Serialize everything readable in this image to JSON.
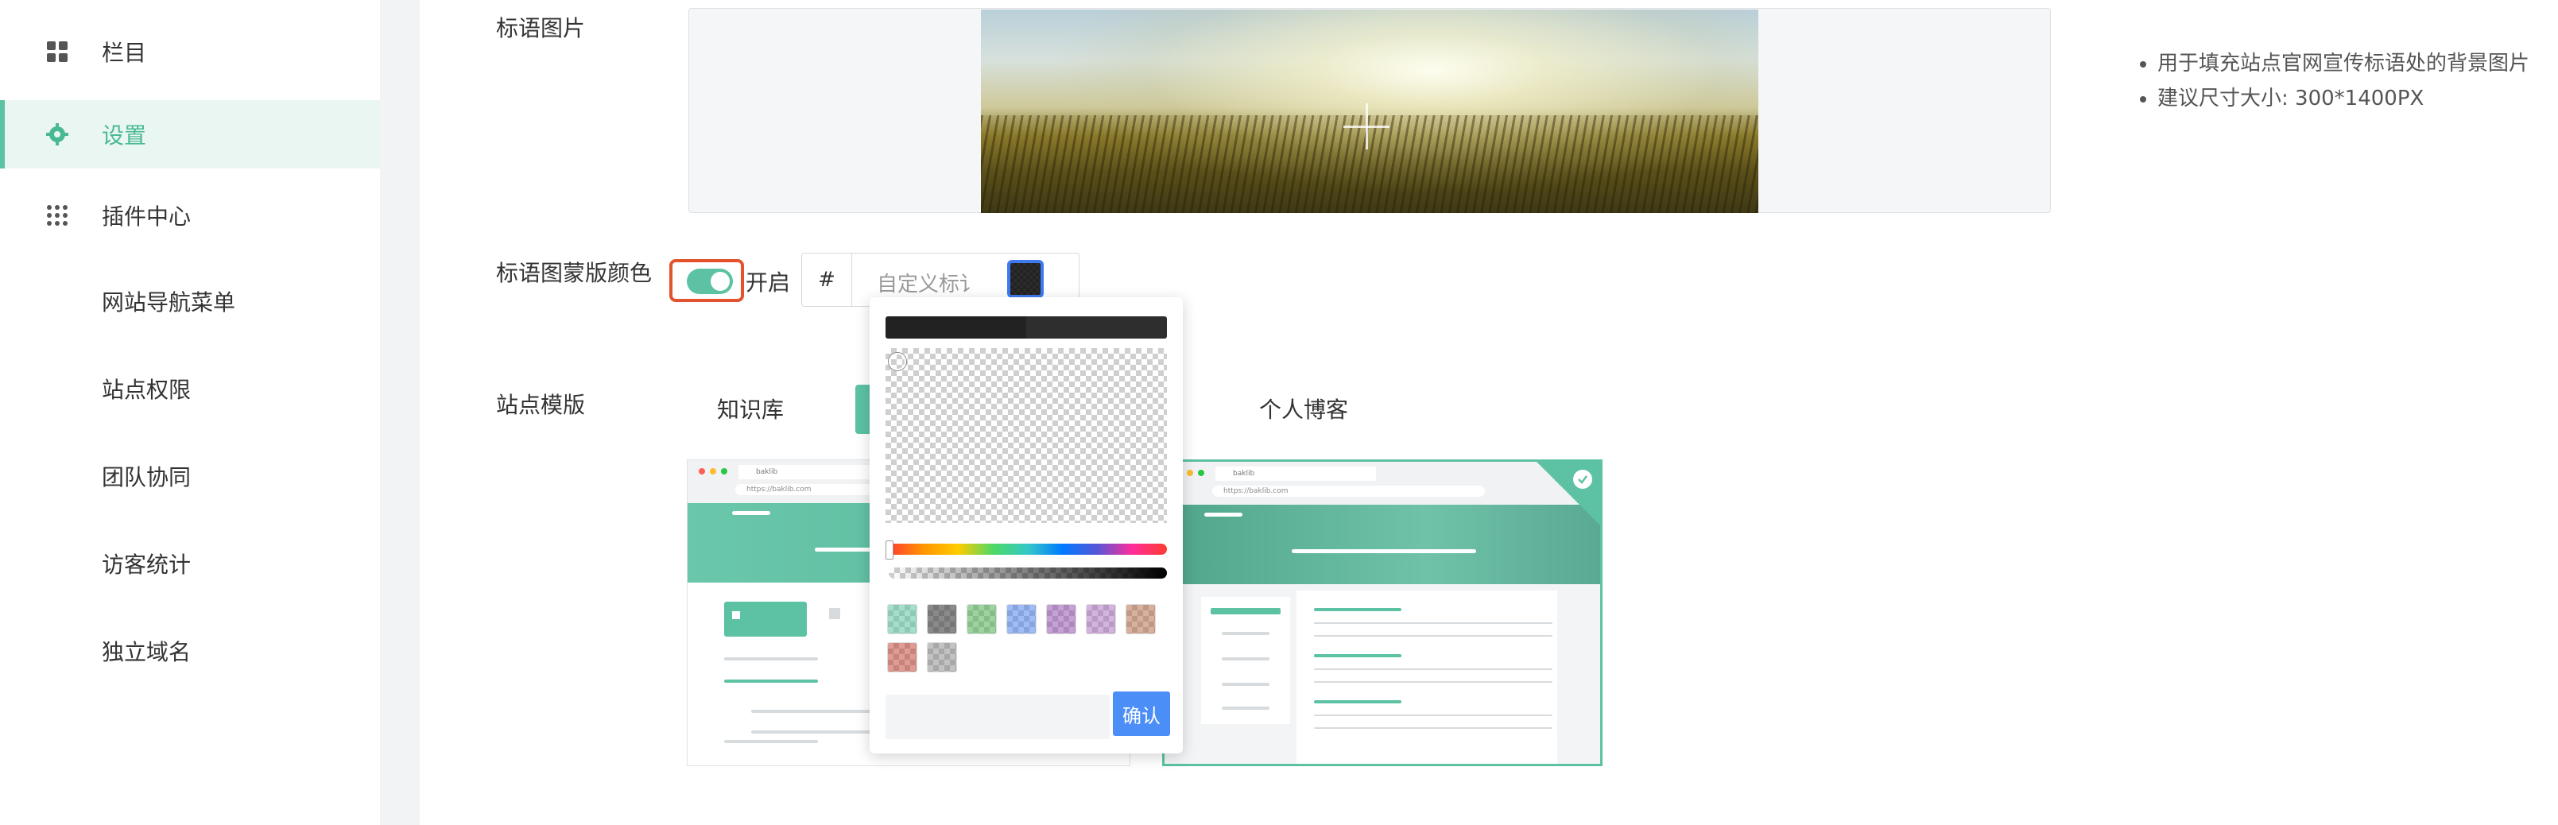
{
  "sidebar": {
    "items": [
      {
        "label": "栏目",
        "icon": "grid-icon"
      },
      {
        "label": "设置",
        "icon": "gear-icon",
        "active": true
      },
      {
        "label": "插件中心",
        "icon": "apps-icon"
      }
    ],
    "sub_items": [
      "网站导航菜单",
      "站点权限",
      "团队协同",
      "访客统计",
      "独立域名"
    ]
  },
  "banner": {
    "label": "标语图片",
    "tips": [
      "用于填充站点官网宣传标语处的背景图片",
      "建议尺寸大小: 300*1400PX"
    ]
  },
  "mask_color": {
    "label": "标语图蒙版颜色",
    "toggle_label": "开启",
    "toggle_on": true,
    "hash": "#",
    "placeholder": "自定义标讠"
  },
  "template": {
    "label": "站点模版",
    "tabs": [
      "知识库",
      "个人博客"
    ],
    "card_url": "https://baklib.com",
    "card_tab_name": "baklib"
  },
  "picker": {
    "confirm_label": "确认",
    "presets": [
      "#5cc2a3",
      "#555555",
      "#4caf50",
      "#3f7af0",
      "#8e44ad",
      "#9b59b6",
      "#c0392b",
      "#c0392b",
      "#9e9e9e"
    ]
  },
  "colors": {
    "accent": "#5cc2a3",
    "highlight": "#e2532e",
    "confirm": "#4c8ef7"
  }
}
